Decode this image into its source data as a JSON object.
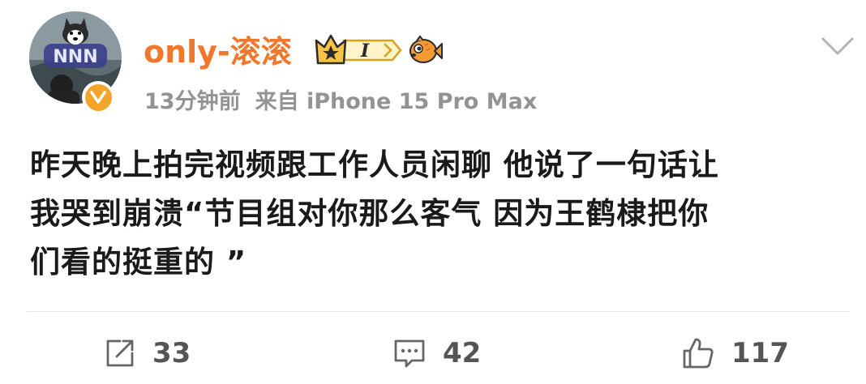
{
  "user": {
    "name": "only-滚滚",
    "level_label": "I",
    "avatar_text": "NNN"
  },
  "meta": {
    "time": "13分钟前",
    "source": "来自 iPhone 15 Pro Max"
  },
  "post": {
    "lines": [
      "昨天晚上拍完视频跟工作人员闲聊 他说了一句话让",
      "我哭到崩溃“节目组对你那么客气 因为王鹤棣把你",
      "们看的挺重的 ”"
    ]
  },
  "actions": {
    "repost_count": "33",
    "comment_count": "42",
    "like_count": "117"
  },
  "icons": {
    "repost": "share-icon",
    "comment": "comment-icon",
    "like": "thumbs-up-icon",
    "more": "chevron-down-icon",
    "verified": "verified-v-icon",
    "level": "crown-level-badge-icon",
    "fan": "fish-emoji-icon"
  },
  "colors": {
    "username": "#f0782d",
    "meta": "#939393",
    "text": "#1a1a1a",
    "verified": "#f3a52a"
  }
}
